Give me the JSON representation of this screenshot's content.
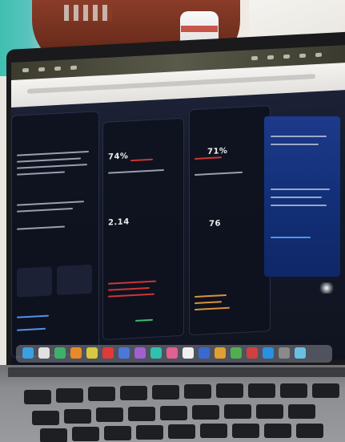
{
  "scene": {
    "subject": "laptop-screen",
    "colors": {
      "screen_bg": "#151a2c",
      "accent_red": "#e23a3a",
      "accent_blue": "#1d3a8a",
      "keyboard": "#1e1f22",
      "chair": "#7a3422"
    }
  },
  "dashboard": {
    "metrics": [
      {
        "value": "74%"
      },
      {
        "value": "71%"
      },
      {
        "value": "2.14"
      },
      {
        "value": "76"
      }
    ]
  }
}
